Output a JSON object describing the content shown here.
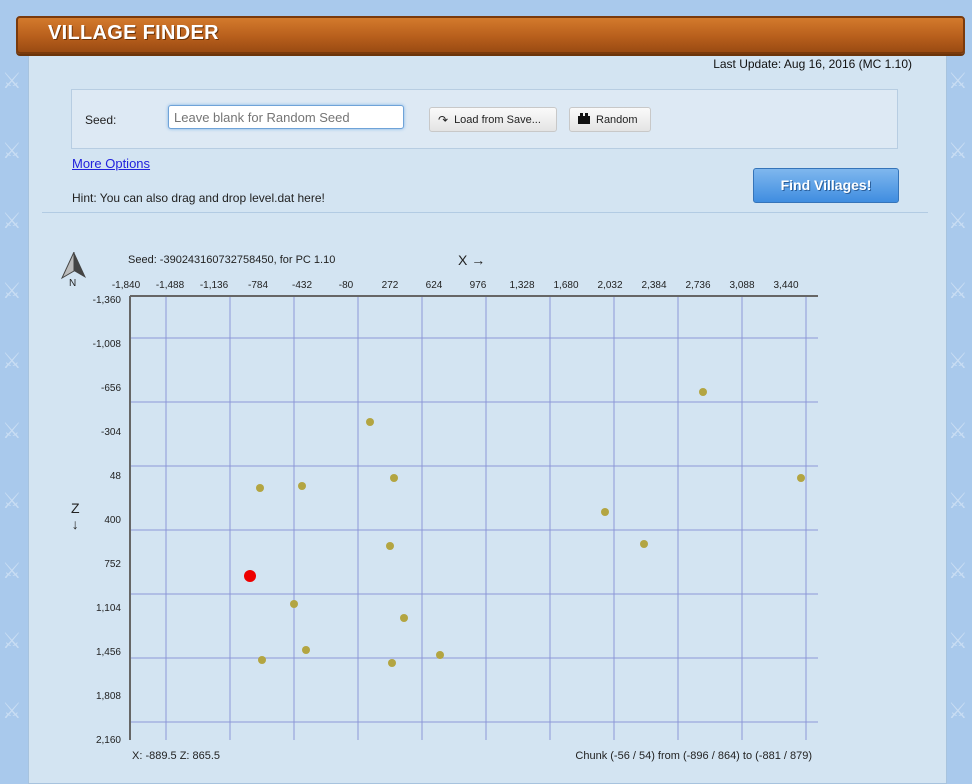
{
  "header": {
    "title": "VILLAGE FINDER"
  },
  "last_update": "Last Update: Aug 16, 2016 (MC 1.10)",
  "seed_form": {
    "label": "Seed:",
    "placeholder": "Leave blank for Random Seed",
    "load_button": "Load from Save...",
    "random_button": "Random",
    "more_options": "More Options",
    "hint": "Hint: You can also drag and drop level.dat here!",
    "find_button": "Find Villages!"
  },
  "icons": {
    "load": "redo-arrow-icon",
    "random": "dice-icon",
    "compass": "north-arrow-icon"
  },
  "map": {
    "compass_label": "N",
    "seed_info": "Seed: -390243160732758450, for PC 1.10",
    "x_axis_label": "X →",
    "z_axis_label": "Z",
    "z_axis_arrow": "↓",
    "cursor_coords": "X: -889.5   Z: 865.5",
    "chunk_info": "Chunk (-56 / 54) from (-896 / 864) to (-881 / 879)",
    "colors": {
      "village": "#b3a542",
      "cursor": "#ee0000",
      "grid": "#8d97d8",
      "axis": "#666666"
    }
  },
  "chart_data": {
    "type": "scatter",
    "x_ticks": [
      "-1,840",
      "-1,488",
      "-1,136",
      "-784",
      "-432",
      "-80",
      "272",
      "624",
      "976",
      "1,328",
      "1,680",
      "2,032",
      "2,384",
      "2,736",
      "3,088",
      "3,440"
    ],
    "y_ticks": [
      "-1,360",
      "-1,008",
      "-656",
      "-304",
      "48",
      "400",
      "752",
      "1,104",
      "1,456",
      "1,808",
      "2,160"
    ],
    "xlim": [
      -1840,
      3440
    ],
    "ylim": [
      -1360,
      2160
    ],
    "villages": [
      {
        "x": 2744,
        "z": -592
      },
      {
        "x": 80,
        "z": -352
      },
      {
        "x": 272,
        "z": 96
      },
      {
        "x": 3528,
        "z": 96
      },
      {
        "x": -464,
        "z": 160
      },
      {
        "x": -800,
        "z": 176
      },
      {
        "x": 1960,
        "z": 368
      },
      {
        "x": 240,
        "z": 640
      },
      {
        "x": 2272,
        "z": 624
      },
      {
        "x": -528,
        "z": 1104
      },
      {
        "x": 352,
        "z": 1216
      },
      {
        "x": -432,
        "z": 1472
      },
      {
        "x": -784,
        "z": 1552
      },
      {
        "x": 256,
        "z": 1576
      },
      {
        "x": 640,
        "z": 1512
      }
    ],
    "selected": {
      "x": -896,
      "z": 864
    }
  }
}
